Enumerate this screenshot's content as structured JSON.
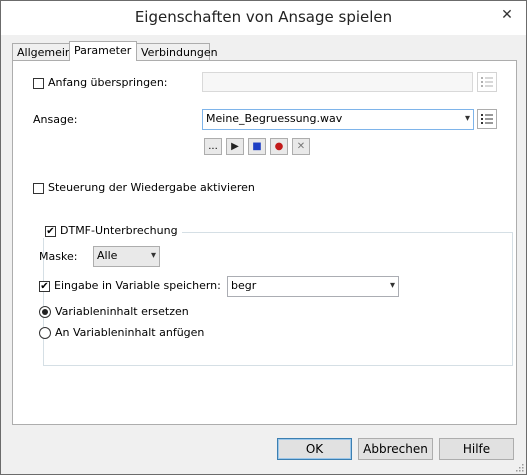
{
  "window": {
    "title": "Eigenschaften von Ansage spielen",
    "close_glyph": "✕"
  },
  "tabs": [
    {
      "label": "Allgemein"
    },
    {
      "label": "Parameter"
    },
    {
      "label": "Verbindungen"
    }
  ],
  "anfang": {
    "label": "Anfang überspringen:",
    "checked": false,
    "value": ""
  },
  "ansage": {
    "label": "Ansage:",
    "value": "Meine_Begruessung.wav"
  },
  "player": {
    "browse": "...",
    "play": "▶",
    "stop": "■",
    "record": "●",
    "delete": "✕"
  },
  "steuerung": {
    "label": "Steuerung der Wiedergabe aktivieren",
    "checked": false
  },
  "dtmf": {
    "label": "DTMF-Unterbrechung",
    "checked": true,
    "maske_label": "Maske:",
    "maske_value": "Alle",
    "eingabe_label": "Eingabe in Variable speichern:",
    "eingabe_checked": true,
    "variable_value": "begr",
    "radio_replace": "Variableninhalt ersetzen",
    "radio_append": "An Variableninhalt anfügen",
    "selected": "replace"
  },
  "buttons": {
    "ok": "OK",
    "cancel": "Abbrechen",
    "help": "Hilfe"
  },
  "icons": {
    "dropdown": "▾",
    "check": "✔"
  }
}
